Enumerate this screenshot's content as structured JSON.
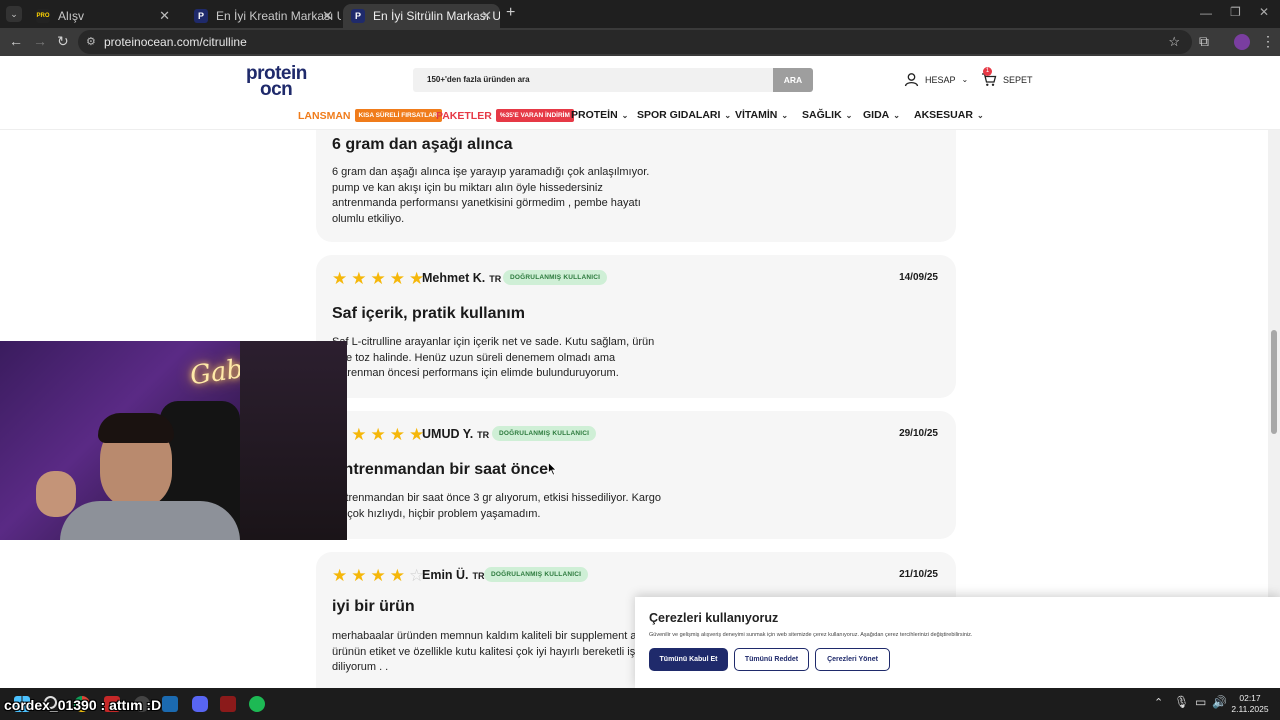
{
  "browser": {
    "tabs": [
      {
        "label": "Alışv",
        "active": false
      },
      {
        "label": "En İyi Kreatin Markası Uygun Fi",
        "active": false
      },
      {
        "label": "En İyi Sitrülin Markası Uygun Fi",
        "active": true
      }
    ],
    "url": "proteinocean.com/citrulline"
  },
  "site": {
    "logo_line1": "protein",
    "logo_line2": "ocn",
    "search_placeholder": "150+'den fazla üründen ara",
    "search_button": "ARA",
    "account_label": "HESAP",
    "cart_label": "SEPET",
    "cart_count": "1",
    "nav": {
      "lansman": "LANSMAN",
      "lansman_badge": "KISA SÜRELİ FIRSATLAR",
      "paketler": "PAKETLER",
      "paketler_badge": "%35'E VARAN İNDİRİM",
      "protein": "PROTEİN",
      "spor": "SPOR GIDALARI",
      "vitamin": "VİTAMİN",
      "saglik": "SAĞLIK",
      "gida": "GIDA",
      "aksesuar": "AKSESUAR"
    }
  },
  "reviews": [
    {
      "title": "6 gram dan aşağı alınca",
      "body": "6 gram dan aşağı alınca işe yarayıp yaramadığı çok anlaşılmıyor. pump ve kan akışı için bu miktarı alın öyle hissedersiniz antrenmanda performansı yanetkisini görmedim , pembe hayatı olumlu etkiliyo."
    },
    {
      "rating": 5,
      "name": "Mehmet K.",
      "country": "TR",
      "verified": "DOĞRULANMIŞ KULLANICI",
      "date": "14/09/25",
      "title": "Saf içerik, pratik kullanım",
      "body": "Saf L-citrulline arayanlar için içerik net ve sade. Kutu sağlam, ürün ince toz halinde. Henüz uzun süreli denemem olmadı ama antrenman öncesi performans için elimde bulunduruyorum."
    },
    {
      "rating": 5,
      "name": "UMUD Y.",
      "country": "TR",
      "verified": "DOĞRULANMIŞ KULLANICI",
      "date": "29/10/25",
      "title": "Antrenmandan bir saat önce",
      "body": "Antrenmandan bir saat önce 3 gr alıyorum, etkisi hissediliyor. Kargo da çok hızlıydı, hiçbir problem yaşamadım."
    },
    {
      "rating": 4,
      "name": "Emin Ü.",
      "country": "TR",
      "verified": "DOĞRULANMIŞ KULLANICI",
      "date": "21/10/25",
      "title": "iyi bir ürün",
      "body": "merhabaalar üründen memnun kaldım kaliteli bir supplement ay ürünün etiket ve özellikle kutu kalitesi çok iyi hayırlı bereketli işle diliyorum . ."
    }
  ],
  "cookie": {
    "title": "Çerezleri kullanıyoruz",
    "text": "Güvenilir ve gelişmiş alışveriş deneyimi sunmak için web sitemizde çerez kullanıyoruz. Aşağıdan çerez tercihlerinizi değiştirebilirsiniz.",
    "accept": "Tümünü Kabul Et",
    "reject": "Tümünü Reddet",
    "manage": "Çerezleri Yönet"
  },
  "webcam": {
    "neon_text": "Gabelo"
  },
  "taskbar": {
    "overlay_text": "cordex_01390 : attım :D",
    "time": "02:17",
    "date": "2.11.2025"
  },
  "colors": {
    "brand_navy": "#1f2a6b",
    "verified_green": "#2c7a3d",
    "star": "#f5b70a"
  }
}
